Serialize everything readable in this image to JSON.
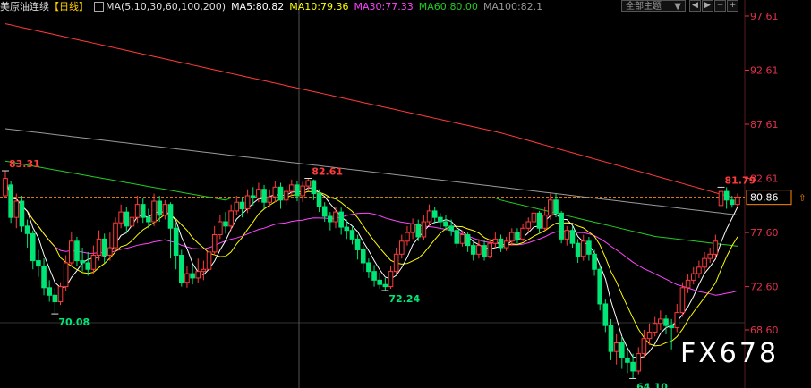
{
  "header": {
    "symbol": "美原油连续",
    "period": "【日线】",
    "ma_params": "MA(5,10,30,60,100,200)",
    "ma5": "MA5:80.82",
    "ma10": "MA10:79.36",
    "ma30": "MA30:77.33",
    "ma60": "MA60:80.00",
    "ma100": "MA100:82.1",
    "theme_label": "全部主题",
    "chevron_icon": "chevron-down-icon",
    "nav_icons": [
      "arrow-left-icon",
      "arrow-right-icon",
      "zoom-out-icon",
      "zoom-in-icon"
    ]
  },
  "colors": {
    "up": "#ff3b3b",
    "down": "#00e676",
    "ma5": "#ffffff",
    "ma10": "#ffff00",
    "ma30": "#ff44ff",
    "ma60": "#22cc22",
    "ma100": "#999999",
    "ma200": "#ff3b3b",
    "axis_text": "#e0324a",
    "grid": "#3a1515"
  },
  "watermark": "FX678",
  "chart_data": {
    "type": "candlestick",
    "y_ticks": [
      "97.61",
      "92.61",
      "87.61",
      "82.61",
      "77.60",
      "72.60",
      "68.60"
    ],
    "y_tick_values": [
      97.61,
      92.61,
      87.61,
      82.61,
      77.6,
      72.6,
      68.6
    ],
    "ylim": [
      64.0,
      99.0
    ],
    "current_price": "80.86",
    "current_price_value": 80.86,
    "annotations": [
      {
        "text": "83.31",
        "index": 0,
        "value": 83.31,
        "kind": "high"
      },
      {
        "text": "70.08",
        "index": 9,
        "value": 70.08,
        "kind": "low"
      },
      {
        "text": "82.61",
        "index": 55,
        "value": 82.61,
        "kind": "high"
      },
      {
        "text": "72.24",
        "index": 69,
        "value": 72.24,
        "kind": "low"
      },
      {
        "text": "64.10",
        "index": 114,
        "value": 64.1,
        "kind": "low"
      },
      {
        "text": "81.79",
        "index": 130,
        "value": 81.79,
        "kind": "high"
      }
    ],
    "candles": [
      [
        81.0,
        82.6,
        80.8,
        83.31
      ],
      [
        82.0,
        79.0,
        78.5,
        82.4
      ],
      [
        79.0,
        80.5,
        78.0,
        81.2
      ],
      [
        80.5,
        78.2,
        77.6,
        81.0
      ],
      [
        78.2,
        77.5,
        76.2,
        78.8
      ],
      [
        77.5,
        75.0,
        74.2,
        77.8
      ],
      [
        75.0,
        74.5,
        73.5,
        76.0
      ],
      [
        74.5,
        72.5,
        71.8,
        75.2
      ],
      [
        72.5,
        71.8,
        71.2,
        73.2
      ],
      [
        71.8,
        71.2,
        70.08,
        72.5
      ],
      [
        71.2,
        72.6,
        70.9,
        73.0
      ],
      [
        72.6,
        74.8,
        72.2,
        75.5
      ],
      [
        74.8,
        76.8,
        74.5,
        77.6
      ],
      [
        76.8,
        75.0,
        74.5,
        77.2
      ],
      [
        75.0,
        74.8,
        74.0,
        76.2
      ],
      [
        74.8,
        74.2,
        73.6,
        75.8
      ],
      [
        74.2,
        75.5,
        73.8,
        76.4
      ],
      [
        75.5,
        77.0,
        75.0,
        77.8
      ],
      [
        77.0,
        75.5,
        74.8,
        77.5
      ],
      [
        75.5,
        76.2,
        75.0,
        77.6
      ],
      [
        76.2,
        78.5,
        75.8,
        79.0
      ],
      [
        78.5,
        79.5,
        78.0,
        80.2
      ],
      [
        79.5,
        78.2,
        77.5,
        80.0
      ],
      [
        78.2,
        79.0,
        77.8,
        80.4
      ],
      [
        79.0,
        80.2,
        78.5,
        81.0
      ],
      [
        80.2,
        79.0,
        78.5,
        80.8
      ],
      [
        79.0,
        78.6,
        78.0,
        79.8
      ],
      [
        78.6,
        80.5,
        78.2,
        81.2
      ],
      [
        80.5,
        79.2,
        78.6,
        81.0
      ],
      [
        79.2,
        80.2,
        78.8,
        80.6
      ],
      [
        80.2,
        78.0,
        75.2,
        80.4
      ],
      [
        78.0,
        75.5,
        74.2,
        78.5
      ],
      [
        75.5,
        73.0,
        72.6,
        76.0
      ],
      [
        73.0,
        73.8,
        72.5,
        74.5
      ],
      [
        73.8,
        73.4,
        72.8,
        74.6
      ],
      [
        73.4,
        74.0,
        72.9,
        75.2
      ],
      [
        74.0,
        74.2,
        73.2,
        75.0
      ],
      [
        74.2,
        75.8,
        73.8,
        76.6
      ],
      [
        75.8,
        77.4,
        75.5,
        78.2
      ],
      [
        77.4,
        78.6,
        77.0,
        79.2
      ],
      [
        78.6,
        78.2,
        77.5,
        79.5
      ],
      [
        78.2,
        79.6,
        77.8,
        80.2
      ],
      [
        79.6,
        80.4,
        79.2,
        81.0
      ],
      [
        80.4,
        79.8,
        79.0,
        80.8
      ],
      [
        79.8,
        81.0,
        79.4,
        81.6
      ],
      [
        81.0,
        80.8,
        80.1,
        81.8
      ],
      [
        80.8,
        81.6,
        80.4,
        82.2
      ],
      [
        81.6,
        80.4,
        79.8,
        82.0
      ],
      [
        80.4,
        80.9,
        80.0,
        81.6
      ],
      [
        80.9,
        81.8,
        80.4,
        82.4
      ],
      [
        81.8,
        80.6,
        79.8,
        82.2
      ],
      [
        80.6,
        81.4,
        80.1,
        81.9
      ],
      [
        81.4,
        82.0,
        81.0,
        82.5
      ],
      [
        82.0,
        81.0,
        80.5,
        82.4
      ],
      [
        81.0,
        81.9,
        80.4,
        82.3
      ],
      [
        81.9,
        82.4,
        81.4,
        82.61
      ],
      [
        82.4,
        81.2,
        80.6,
        82.5
      ],
      [
        81.2,
        80.0,
        79.5,
        81.6
      ],
      [
        80.0,
        79.1,
        78.6,
        80.4
      ],
      [
        79.1,
        78.6,
        77.8,
        79.5
      ],
      [
        78.6,
        79.5,
        78.0,
        80.0
      ],
      [
        79.5,
        78.1,
        77.4,
        79.9
      ],
      [
        78.1,
        77.8,
        77.0,
        78.8
      ],
      [
        77.8,
        77.0,
        76.5,
        78.2
      ],
      [
        77.0,
        76.0,
        75.1,
        77.4
      ],
      [
        76.0,
        74.8,
        74.0,
        76.4
      ],
      [
        74.8,
        74.0,
        73.4,
        75.2
      ],
      [
        74.0,
        73.2,
        72.6,
        74.6
      ],
      [
        73.2,
        72.8,
        72.4,
        73.9
      ],
      [
        72.8,
        72.6,
        72.24,
        73.4
      ],
      [
        72.6,
        74.0,
        72.4,
        74.5
      ],
      [
        74.0,
        75.6,
        73.8,
        76.2
      ],
      [
        75.6,
        76.8,
        75.2,
        77.4
      ],
      [
        76.8,
        77.6,
        76.4,
        78.2
      ],
      [
        77.6,
        78.4,
        77.0,
        78.9
      ],
      [
        78.4,
        77.2,
        76.8,
        78.8
      ],
      [
        77.2,
        78.6,
        76.9,
        79.2
      ],
      [
        78.6,
        79.6,
        78.2,
        80.2
      ],
      [
        79.6,
        79.0,
        78.4,
        80.0
      ],
      [
        79.0,
        78.6,
        78.0,
        79.4
      ],
      [
        78.6,
        78.2,
        77.8,
        79.2
      ],
      [
        78.2,
        77.8,
        77.3,
        78.8
      ],
      [
        77.8,
        76.6,
        76.2,
        78.2
      ],
      [
        76.6,
        77.4,
        76.3,
        77.8
      ],
      [
        77.4,
        76.4,
        75.8,
        77.6
      ],
      [
        76.4,
        75.6,
        75.0,
        76.8
      ],
      [
        75.6,
        76.4,
        75.2,
        77.0
      ],
      [
        76.4,
        75.4,
        75.0,
        76.9
      ],
      [
        75.4,
        76.6,
        75.2,
        77.0
      ],
      [
        76.6,
        77.0,
        76.2,
        77.6
      ],
      [
        77.0,
        76.2,
        75.8,
        77.4
      ],
      [
        76.2,
        76.8,
        75.9,
        77.2
      ],
      [
        76.8,
        77.6,
        76.4,
        78.0
      ],
      [
        77.6,
        77.0,
        76.6,
        78.0
      ],
      [
        77.0,
        78.0,
        76.8,
        78.4
      ],
      [
        78.0,
        78.6,
        77.6,
        79.0
      ],
      [
        78.6,
        79.4,
        78.2,
        80.0
      ],
      [
        79.4,
        78.0,
        77.5,
        79.6
      ],
      [
        78.0,
        79.2,
        77.8,
        80.0
      ],
      [
        79.2,
        80.6,
        78.8,
        81.2
      ],
      [
        80.6,
        79.4,
        79.0,
        81.2
      ],
      [
        79.4,
        77.0,
        76.6,
        79.6
      ],
      [
        77.0,
        77.8,
        76.4,
        78.2
      ],
      [
        77.8,
        76.6,
        76.2,
        78.2
      ],
      [
        76.6,
        75.4,
        74.8,
        77.0
      ],
      [
        75.4,
        76.8,
        75.0,
        77.4
      ],
      [
        76.8,
        75.6,
        75.0,
        77.2
      ],
      [
        75.6,
        74.2,
        73.6,
        76.0
      ],
      [
        74.2,
        71.0,
        70.4,
        74.6
      ],
      [
        71.0,
        69.0,
        68.4,
        71.4
      ],
      [
        69.0,
        66.6,
        65.8,
        69.6
      ],
      [
        66.6,
        67.4,
        65.4,
        68.2
      ],
      [
        67.4,
        66.0,
        65.0,
        68.0
      ],
      [
        66.0,
        65.6,
        64.6,
        66.8
      ],
      [
        65.6,
        64.8,
        64.1,
        66.4
      ],
      [
        64.8,
        66.4,
        64.5,
        67.0
      ],
      [
        66.4,
        67.8,
        66.0,
        68.6
      ],
      [
        67.8,
        68.4,
        67.2,
        69.2
      ],
      [
        68.4,
        69.2,
        68.0,
        69.8
      ],
      [
        69.2,
        69.6,
        68.6,
        70.4
      ],
      [
        69.6,
        69.0,
        68.2,
        70.0
      ],
      [
        69.0,
        68.8,
        66.8,
        69.6
      ],
      [
        68.8,
        70.2,
        68.4,
        71.0
      ],
      [
        70.2,
        72.5,
        69.8,
        73.0
      ],
      [
        72.5,
        73.2,
        72.0,
        73.8
      ],
      [
        73.2,
        73.8,
        72.8,
        74.4
      ],
      [
        73.8,
        74.4,
        73.4,
        75.0
      ],
      [
        74.4,
        75.2,
        74.0,
        75.8
      ],
      [
        75.2,
        75.6,
        74.8,
        76.2
      ],
      [
        75.6,
        76.8,
        75.2,
        77.4
      ],
      [
        80.1,
        81.4,
        79.6,
        81.8
      ],
      [
        81.4,
        80.6,
        79.8,
        81.79
      ],
      [
        80.6,
        80.2,
        79.9,
        81.0
      ],
      [
        80.2,
        80.86,
        80.0,
        81.2
      ]
    ],
    "x_offset": 0
  }
}
